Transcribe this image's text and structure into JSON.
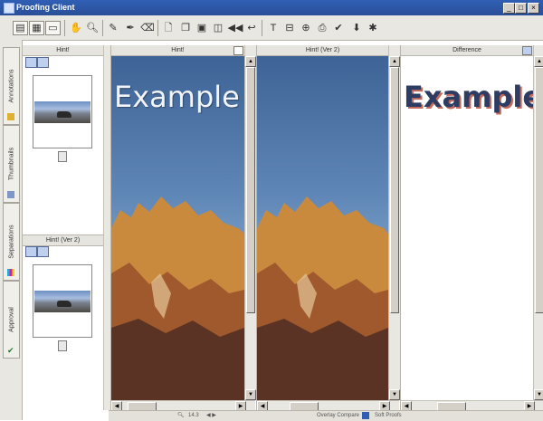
{
  "window": {
    "title": "Proofing Client",
    "minimize": "_",
    "maximize": "□",
    "close": "×"
  },
  "toolbar": {
    "icons": [
      "layout-icon",
      "layout-alt-icon",
      "window-icon",
      "hand-tool-icon",
      "zoom-icon",
      "annotation-icon",
      "pen-icon",
      "eraser-icon",
      "page-icon",
      "page-pair-icon",
      "page-view-icon",
      "compare-icon",
      "rewind-icon",
      "back-icon",
      "text-tool-icon",
      "stamp-icon",
      "measure-icon",
      "print-icon",
      "approve-icon",
      "download-icon",
      "pin-icon"
    ]
  },
  "vertical_tabs": [
    "Annotations",
    "Thumbnails",
    "Separations",
    "Approval"
  ],
  "thumbnails": {
    "panel1_header": "Hint!",
    "panel2_header": "Hint! (Ver 2)"
  },
  "panels": {
    "left": {
      "header": "Hint!",
      "text": "Example"
    },
    "middle": {
      "header": "Hint! (Ver 2)",
      "text": "Example"
    },
    "right": {
      "header": "Difference",
      "text": "Example"
    }
  },
  "status": {
    "zoom": "14.3",
    "compare_mode": "Overlay Compare",
    "layers": "Soft Proofs"
  },
  "colors": {
    "titlebar": "#2f5fb4",
    "toolbar_bg": "#e9e7e1",
    "sky_top": "#3e6396",
    "rock": "#c98a3e"
  }
}
